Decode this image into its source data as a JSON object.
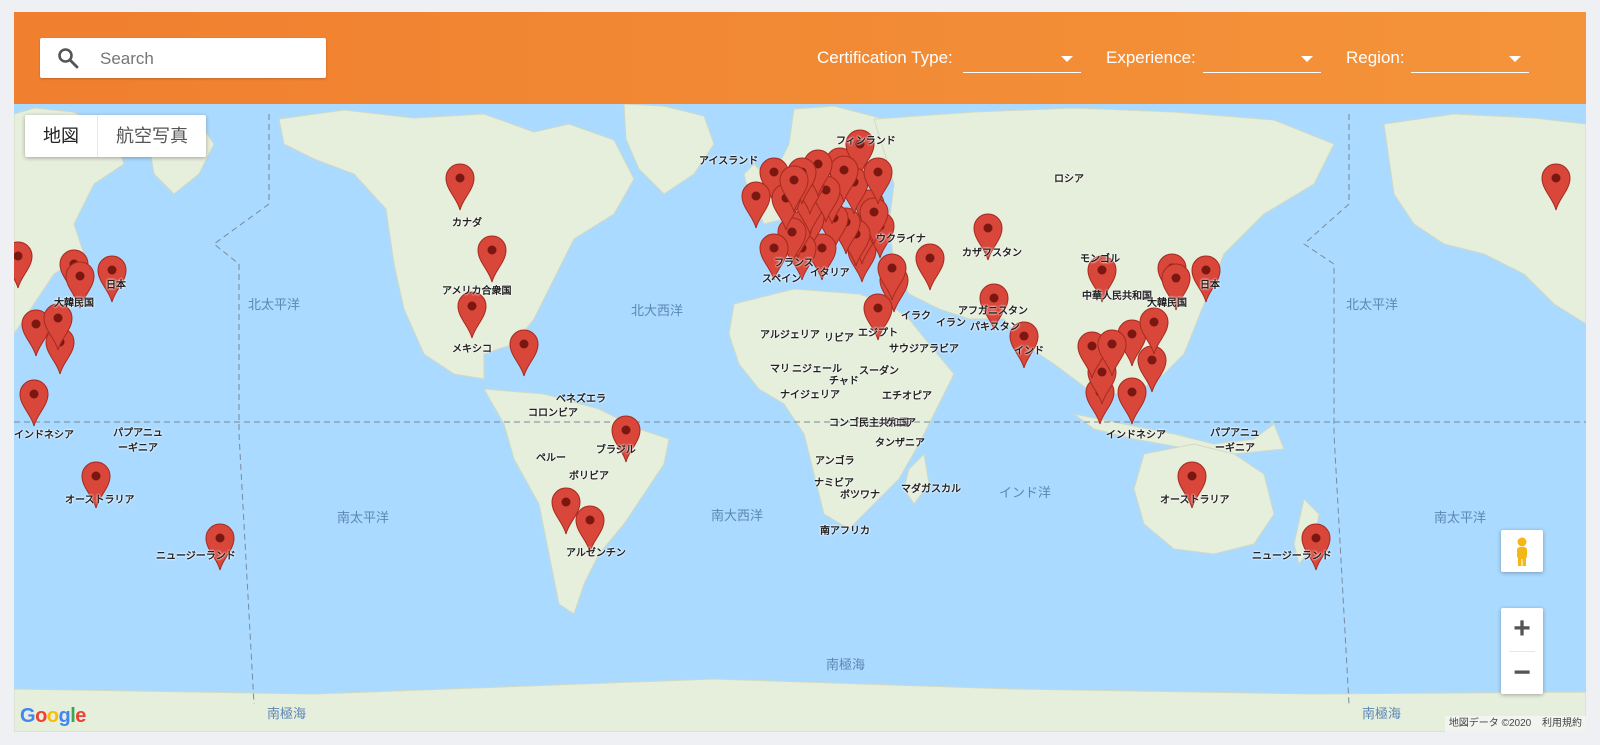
{
  "search": {
    "placeholder": "Search",
    "icon": "search-icon"
  },
  "filters": [
    {
      "label": "Certification Type:",
      "value": ""
    },
    {
      "label": "Experience:",
      "value": ""
    },
    {
      "label": "Region:",
      "value": ""
    }
  ],
  "map_type": {
    "map": "地図",
    "satellite": "航空写真"
  },
  "zoom": {
    "in": "+",
    "out": "−"
  },
  "attribution": {
    "data": "地図データ ©2020",
    "terms": "利用規約"
  },
  "logo": "Google",
  "colors": {
    "accent": "#f07f2f",
    "water": "#aadaff",
    "land": "#e6eedc",
    "marker": "#d9463a"
  },
  "oceans": [
    "北太平洋",
    "北大西洋",
    "南太平洋",
    "南大西洋",
    "インド洋",
    "南極海"
  ],
  "countries": [
    "アイスランド",
    "フィンランド",
    "ロシア",
    "カナダ",
    "アメリカ合衆国",
    "メキシコ",
    "ベネズエラ",
    "コロンビア",
    "ペルー",
    "ブラジル",
    "ボリビア",
    "アルゼンチン",
    "アルジェリア",
    "リビア",
    "エジプト",
    "マリ",
    "ニジェール",
    "チャド",
    "スーダン",
    "ナイジェリア",
    "エチオピア",
    "コンゴ民主共和国",
    "ケニア",
    "タンザニア",
    "アンゴラ",
    "ナミビア",
    "ボツワナ",
    "マダガスカル",
    "南アフリカ",
    "カザフスタン",
    "モンゴル",
    "中華人民共和国",
    "アフガニスタン",
    "パキスタン",
    "イラン",
    "イラク",
    "サウジアラビア",
    "インド",
    "インドネシア",
    "パプアニューギニア",
    "オーストラリア",
    "ニュージーランド",
    "大韓民国",
    "日本",
    "フランス",
    "スペイン",
    "イタリア",
    "ウクライナ"
  ]
}
